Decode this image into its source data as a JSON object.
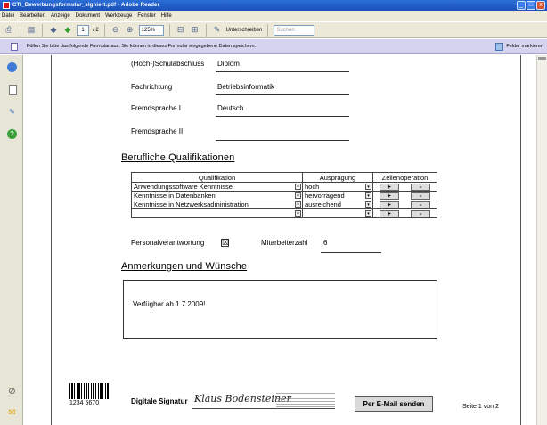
{
  "window": {
    "title": "CTI_Bewerbungsformular_signiert.pdf - Adobe Reader",
    "buttons": [
      "_",
      "□",
      "x"
    ]
  },
  "menu": [
    "Datei",
    "Bearbeiten",
    "Anzeige",
    "Dokument",
    "Werkzeuge",
    "Fenster",
    "Hilfe"
  ],
  "toolbar": {
    "page_current": "1",
    "page_total": "/ 2",
    "zoom": "125%",
    "sign_label": "Unterschreiben",
    "search_placeholder": "Suchen"
  },
  "notification": {
    "text": "Füllen Sie bitte das folgende Formular aus. Sie können in dieses Formular eingegebene Daten speichern.",
    "highlight_label": "Felder markieren"
  },
  "form": {
    "degree_label": "(Hoch-)Schulabschluss",
    "degree_value": "Diplom",
    "field_label": "Fachrichtung",
    "field_value": "Betriebsinformatik",
    "lang1_label": "Fremdsprache I",
    "lang1_value": "Deutsch",
    "lang2_label": "Fremdsprache II",
    "lang2_value": ""
  },
  "qualifications": {
    "title": "Berufliche Qualifikationen",
    "headers": [
      "Qualifikation",
      "Ausprägung",
      "Zeilenoperation"
    ],
    "rows": [
      {
        "qualification": "Anwendungssoftware Kenntnisse",
        "level": "hoch"
      },
      {
        "qualification": "Kenntnisse in Datenbanken",
        "level": "hervorragend"
      },
      {
        "qualification": "Kenntnisse in Netzwerksadministration",
        "level": "ausreichend"
      },
      {
        "qualification": "",
        "level": ""
      }
    ],
    "add_label": "+",
    "remove_label": "-",
    "dropdown_glyph": "▾"
  },
  "staff": {
    "responsibility_label": "Personalverantwortung",
    "responsibility_checked": "☒",
    "count_label": "Mitarbeiterzahl",
    "count_value": "6"
  },
  "remarks": {
    "title": "Anmerkungen und Wünsche",
    "text": "Verfügbar ab 1.7.2009!"
  },
  "footer": {
    "barcode_digits": "1234 5670",
    "signature_label": "Digitale Signatur",
    "signature_name": "Klaus Bodensteiner",
    "email_button": "Per E-Mail senden",
    "page_indicator": "Seite 1 von 2"
  }
}
